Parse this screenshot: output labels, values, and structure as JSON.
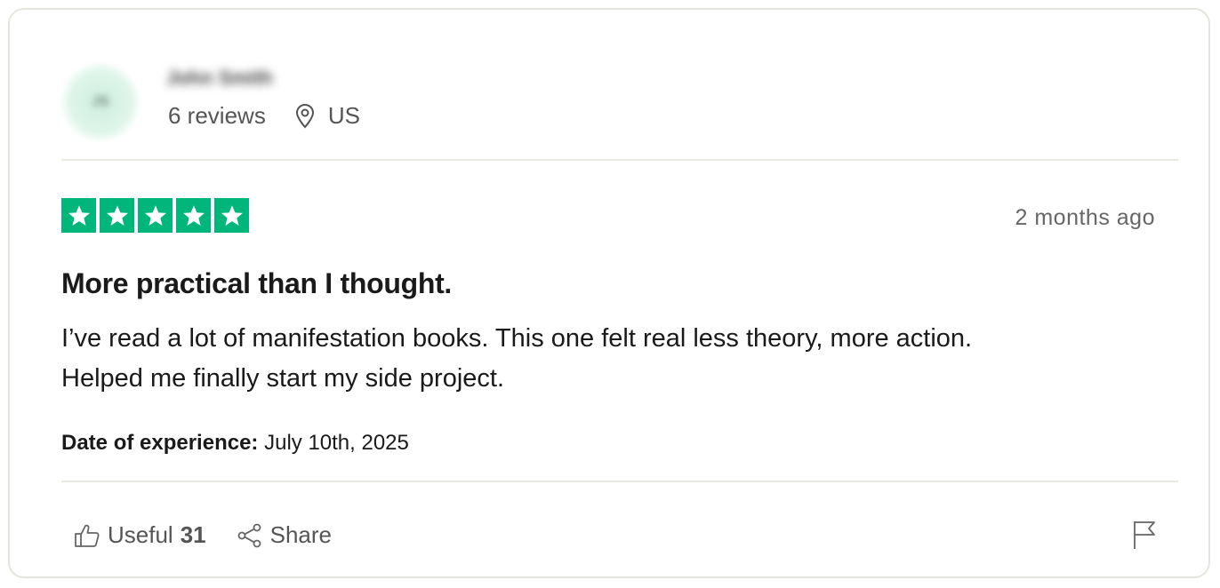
{
  "reviewer": {
    "initials": "JS",
    "name": "John Smith",
    "reviews_count": "6 reviews",
    "country": "US"
  },
  "review": {
    "rating": 5,
    "time_ago": "2 months ago",
    "title": "More practical than I thought.",
    "body_line1": "I’ve read a lot of manifestation books. This one felt real less theory, more action.",
    "body_line2": "Helped me finally start my side project.",
    "experience_label": "Date of experience:",
    "experience_date": "July 10th, 2025"
  },
  "actions": {
    "useful_label": "Useful",
    "useful_count": "31",
    "share_label": "Share"
  },
  "colors": {
    "star_green": "#00b67a",
    "divider": "#e8e8e3"
  },
  "icons": [
    "location-pin-icon",
    "star-icon",
    "thumbs-up-icon",
    "share-icon",
    "flag-icon"
  ]
}
